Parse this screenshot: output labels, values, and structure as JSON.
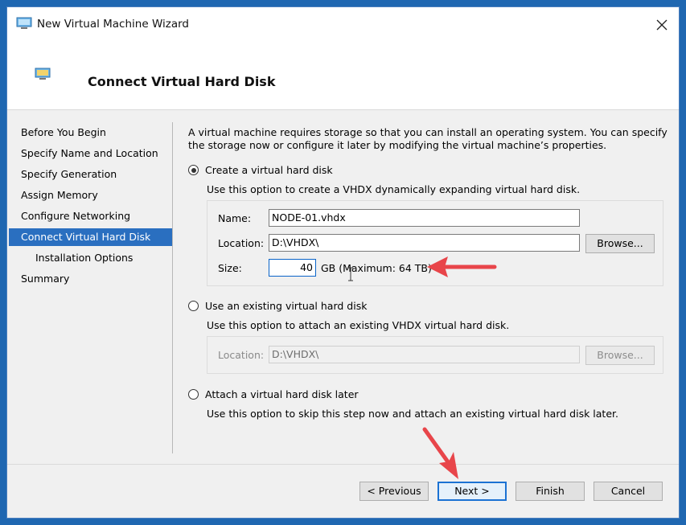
{
  "window": {
    "title": "New Virtual Machine Wizard",
    "page_title": "Connect Virtual Hard Disk"
  },
  "nav": {
    "items": [
      {
        "label": "Before You Begin"
      },
      {
        "label": "Specify Name and Location"
      },
      {
        "label": "Specify Generation"
      },
      {
        "label": "Assign Memory"
      },
      {
        "label": "Configure Networking"
      },
      {
        "label": "Connect Virtual Hard Disk"
      },
      {
        "label": "Installation Options"
      },
      {
        "label": "Summary"
      }
    ],
    "active_index": 5
  },
  "intro_text": "A virtual machine requires storage so that you can install an operating system. You can specify the storage now or configure it later by modifying the virtual machine’s properties.",
  "options": {
    "create": {
      "label": "Create a virtual hard disk",
      "description": "Use this option to create a VHDX dynamically expanding virtual hard disk.",
      "selected": true,
      "name_label": "Name:",
      "name_value": "NODE-01.vhdx",
      "location_label": "Location:",
      "location_value": "D:\\VHDX\\",
      "browse_label": "Browse...",
      "size_label": "Size:",
      "size_value": "40",
      "size_unit_text": "GB (Maximum: 64 TB)"
    },
    "existing": {
      "label": "Use an existing virtual hard disk",
      "description": "Use this option to attach an existing VHDX virtual hard disk.",
      "selected": false,
      "location_label": "Location:",
      "location_value": "D:\\VHDX\\",
      "browse_label": "Browse..."
    },
    "later": {
      "label": "Attach a virtual hard disk later",
      "description": "Use this option to skip this step now and attach an existing virtual hard disk later.",
      "selected": false
    }
  },
  "buttons": {
    "previous": "< Previous",
    "next": "Next >",
    "finish": "Finish",
    "cancel": "Cancel"
  },
  "colors": {
    "accent": "#2a6fc0",
    "annotation_arrow": "#e8454a"
  },
  "icons": {
    "window": "vm-monitor-icon",
    "close": "close-icon",
    "page": "vm-monitor-icon"
  }
}
